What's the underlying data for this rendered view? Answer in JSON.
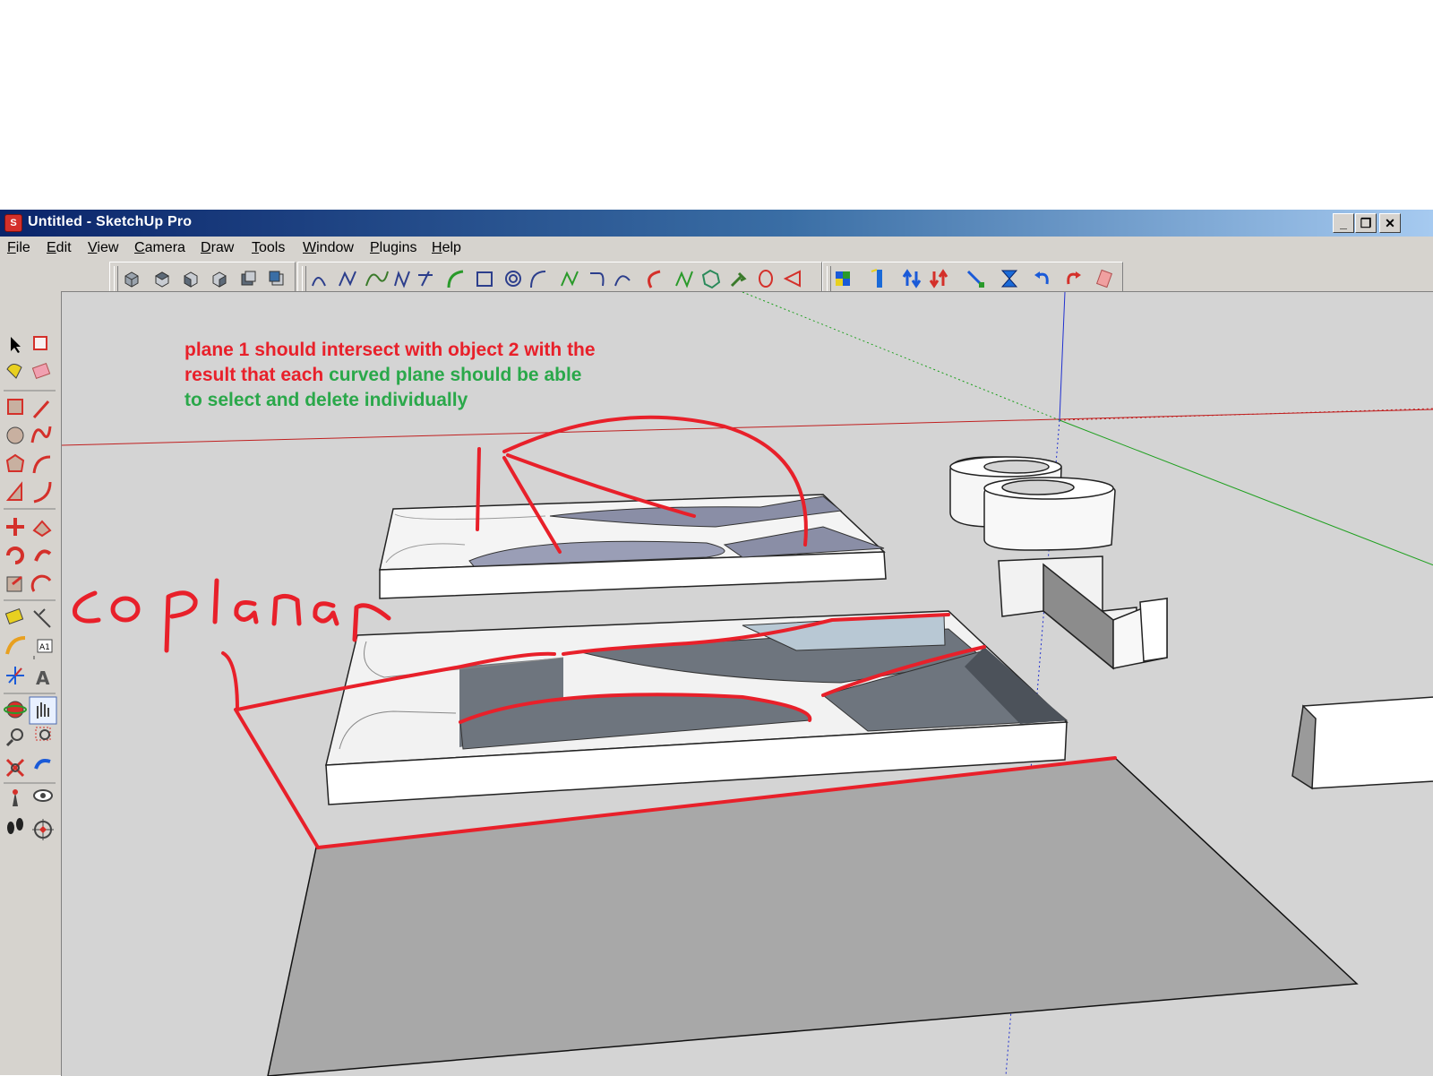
{
  "window": {
    "title": "Untitled - SketchUp Pro",
    "app_icon": "sketchup-logo-icon",
    "controls": [
      "minimize-icon",
      "restore-icon",
      "close-icon"
    ]
  },
  "menu": {
    "items": [
      "File",
      "Edit",
      "View",
      "Camera",
      "Draw",
      "Tools",
      "Window",
      "Plugins",
      "Help"
    ]
  },
  "toolbars": {
    "views": [
      "iso-view-icon",
      "top-view-icon",
      "front-view-icon",
      "right-view-icon",
      "back-view-icon",
      "left-view-icon"
    ],
    "plugins": [
      "bezier-icon",
      "curve-icon",
      "spline-icon",
      "polyline-icon",
      "segment-icon",
      "arc-icon",
      "rectangle-icon",
      "spiral-icon",
      "curve2-icon",
      "zigzag-icon",
      "hook-icon",
      "arc2-icon",
      "arc3-icon",
      "freehand-icon",
      "polygon-icon",
      "wrench-icon",
      "ellipse-icon",
      "cone-icon"
    ],
    "sandbox": [
      "color-cube-icon",
      "extrude-icon",
      "push-up-icon",
      "push-down-icon",
      "scale-diagonal-icon",
      "hourglass-icon",
      "undo-icon",
      "redo-icon",
      "eraser-icon"
    ]
  },
  "left_toolbar": [
    "select-icon",
    "make-component-icon",
    "paint-bucket-icon",
    "eraser-icon",
    "rectangle-icon",
    "pencil-icon",
    "circle-icon",
    "arc-icon",
    "polygon-icon",
    "freehand-icon",
    "move-icon",
    "push-pull-icon",
    "rotate-icon",
    "follow-me-icon",
    "scale-icon",
    "offset-icon",
    "tape-measure-icon",
    "dimension-icon",
    "protractor-icon",
    "text-icon",
    "axes-icon",
    "3d-text-icon",
    "orbit-icon",
    "pan-icon",
    "zoom-icon",
    "zoom-window-icon",
    "zoom-extents-icon",
    "previous-icon",
    "position-camera-icon",
    "look-around-icon",
    "walk-icon",
    "section-plane-icon"
  ],
  "annotation": {
    "line1": "plane 1 should intersect with object 2 with the",
    "line2_red": "result that each ",
    "line2_green": "curved plane should be able",
    "line3": "to select and delete individually",
    "handwritten": "coplanar",
    "red": "#e8202a",
    "green": "#2aa84a"
  }
}
